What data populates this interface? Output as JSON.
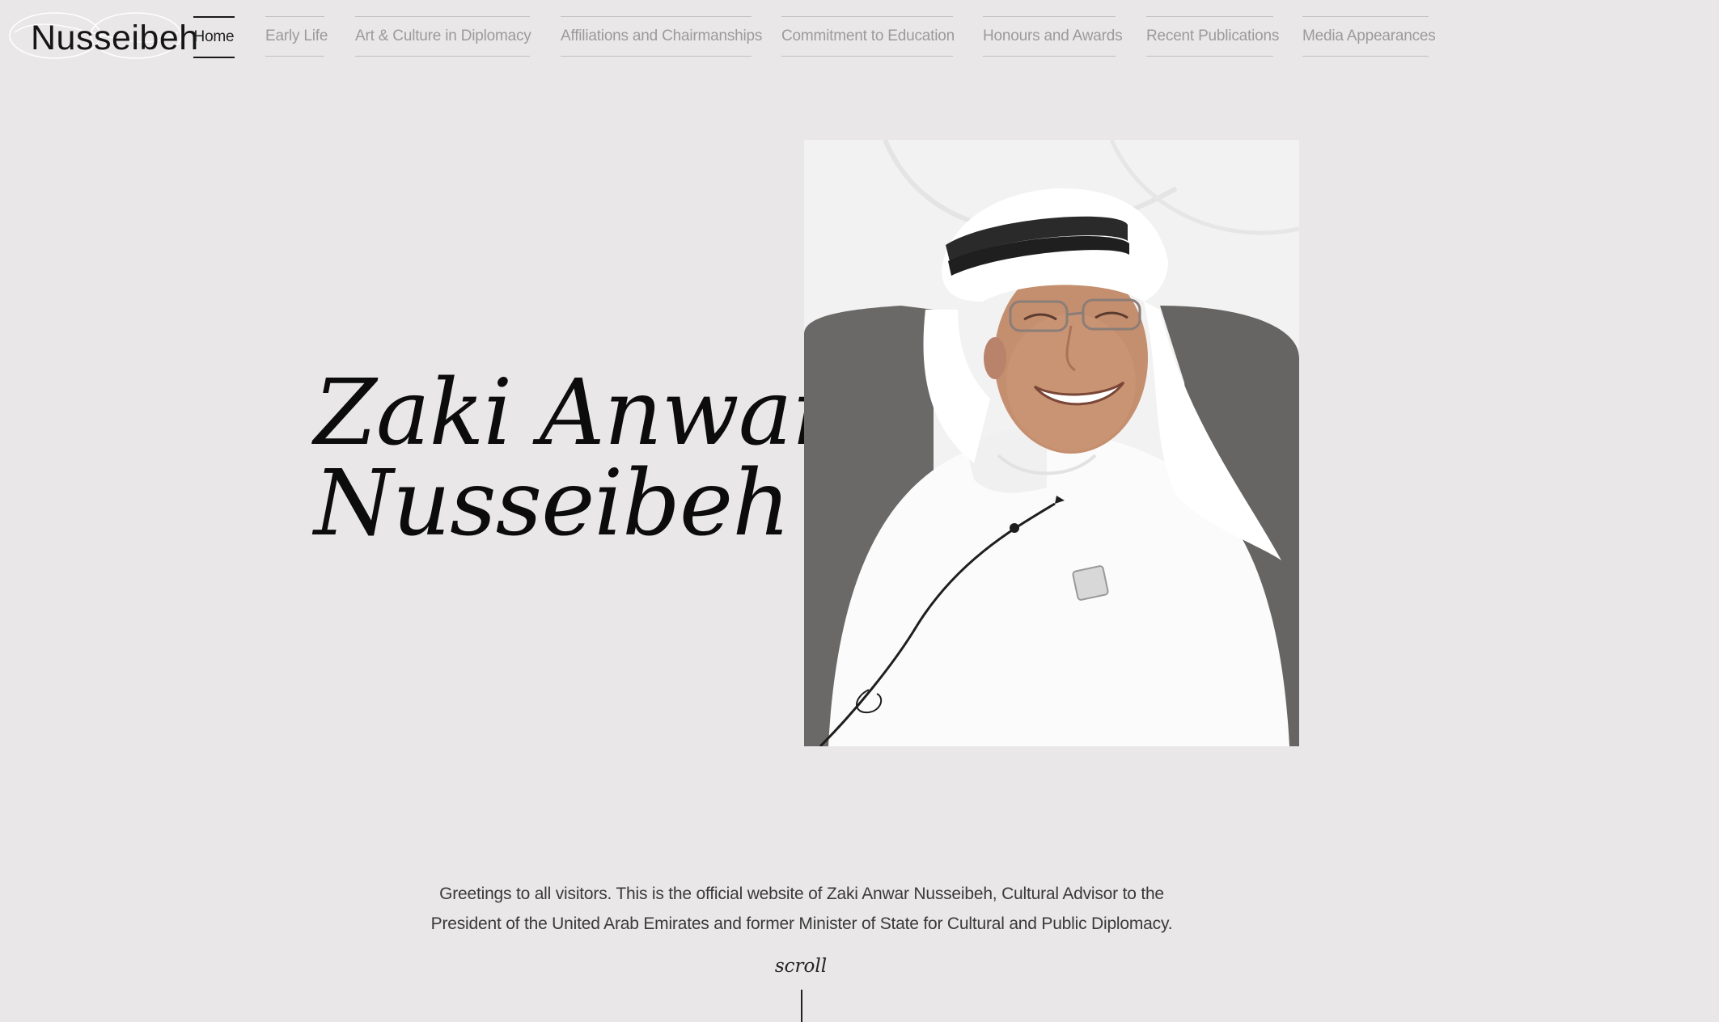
{
  "site": {
    "logo_text": "Nusseibeh"
  },
  "nav": {
    "items": [
      {
        "label": "Home",
        "active": true
      },
      {
        "label": "Early Life",
        "active": false
      },
      {
        "label": "Art & Culture in Diplomacy",
        "active": false
      },
      {
        "label": "Affiliations and Chairmanships",
        "active": false
      },
      {
        "label": "Commitment to Education",
        "active": false
      },
      {
        "label": "Honours and Awards",
        "active": false
      },
      {
        "label": "Recent Publications",
        "active": false
      },
      {
        "label": "Media Appearances",
        "active": false
      }
    ]
  },
  "hero": {
    "name_line1": "Zaki Anwar",
    "name_line2": "Nusseibeh"
  },
  "intro": {
    "text": "Greetings to all visitors. This is the official website of Zaki Anwar Nusseibeh, Cultural Advisor to the President of the United Arab Emirates and former Minister of State for Cultural and Public Diplomacy."
  },
  "scroll": {
    "label": "scroll"
  },
  "colors": {
    "background": "#e9e7e8",
    "nav_inactive": "#9c9a9b",
    "nav_active": "#222222",
    "heading": "#0c0c0c"
  }
}
